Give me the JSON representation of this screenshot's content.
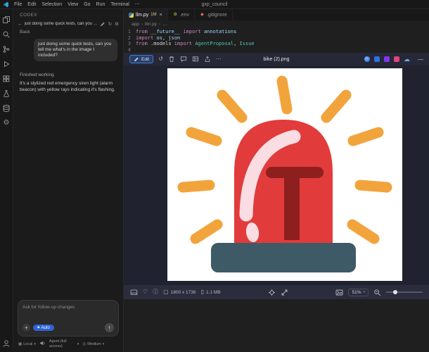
{
  "menubar": {
    "items": [
      "File",
      "Edit",
      "Selection",
      "View",
      "Go",
      "Run",
      "Terminal"
    ],
    "overflow": "⋯",
    "title": "gxp_council"
  },
  "activity_bar": {
    "top_icons": [
      "files",
      "search",
      "source-control",
      "run-debug",
      "extensions",
      "testing",
      "database",
      "settings"
    ],
    "bottom_icons": [
      "account"
    ]
  },
  "sidebar": {
    "panel_title": "CODEX",
    "thread": {
      "back_glyph": "←",
      "title": "just doing some quick tests, can you t...",
      "action_icons": [
        "edit",
        "refresh",
        "settings"
      ],
      "refresh_glyph": "↻",
      "settings_glyph": "⚙",
      "back_label": "Back"
    },
    "chat": {
      "user_message": "just doing some quick tests, can you tell me what's in the image I included?",
      "status_header": "Finished working",
      "assistant_message": "It's a stylized red emergency siren light (alarm beacon) with yellow rays indicating it's flashing."
    },
    "composer": {
      "placeholder": "Ask for follow-up changes",
      "plus_glyph": "+",
      "auto_label": "Auto",
      "send_glyph": "↑"
    },
    "footer": {
      "local_label": "Local",
      "agent_label": "Agent (full access)",
      "model_label": "Medium",
      "caret_glyph": "▾"
    }
  },
  "editor": {
    "tabs": [
      {
        "label": "llm.py",
        "icon": "python",
        "badge": "1M",
        "close_glyph": "×",
        "active": true
      },
      {
        "label": ".env",
        "icon": "gear",
        "active": false
      },
      {
        "label": ".gitignore",
        "icon": "git",
        "active": false
      }
    ],
    "breadcrumb": [
      "app",
      "llm.py",
      "…"
    ],
    "code_lines": [
      {
        "num": "1",
        "tokens": [
          [
            "kw",
            "from "
          ],
          [
            "mod",
            "__future__"
          ],
          [
            "kw",
            " import "
          ],
          [
            "mod",
            "annotations"
          ]
        ]
      },
      {
        "num": "2",
        "tokens": [
          [
            "kw",
            "import "
          ],
          [
            "mod",
            "os"
          ],
          [
            "plain",
            ", "
          ],
          [
            "mod",
            "json"
          ]
        ]
      },
      {
        "num": "3",
        "tokens": [
          [
            "kw",
            "from "
          ],
          [
            "plain",
            ".models "
          ],
          [
            "kw",
            "import "
          ],
          [
            "cls",
            "AgentProposal"
          ],
          [
            "plain",
            ", "
          ],
          [
            "cls",
            "Issue"
          ]
        ]
      },
      {
        "num": "4",
        "tokens": []
      }
    ]
  },
  "image_panel": {
    "header": {
      "edit_button": "Edit",
      "action_icons": [
        "undo",
        "delete",
        "comment",
        "layout",
        "share",
        "more"
      ],
      "undo_glyph": "↺",
      "more_glyph": "⋯",
      "filename": "bike (2).png",
      "app_icons": [
        "codex-blue",
        "app-blue",
        "app-purple",
        "app-pink",
        "cloud"
      ],
      "minimize_glyph": "—"
    },
    "artwork": {
      "background": "#ffffff",
      "dome_color": "#e23b3b",
      "dark_red": "#8e1f1f",
      "highlight_color": "#f9dde2",
      "base_color": "#3e5a66",
      "ray_color": "#f2a43c"
    },
    "toolbar": {
      "left_icons": [
        "panel",
        "favorite",
        "info"
      ],
      "favorite_glyph": "♡",
      "info_glyph": "ⓘ",
      "dimensions_glyph": "▢",
      "dimensions": "1800 x 1736",
      "file_glyph": "▯",
      "file_size": "1.1 MB",
      "center_icons": [
        "center-view",
        "resize"
      ],
      "right_icons": [
        "picture",
        "zoom-select",
        "zoom-out",
        "zoom-slider"
      ],
      "zoom": "51%"
    }
  }
}
